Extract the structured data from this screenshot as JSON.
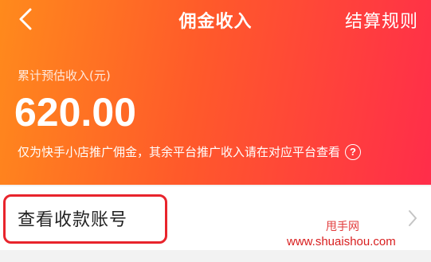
{
  "nav": {
    "title": "佣金收入",
    "rules_label": "结算规则",
    "back_icon": "chevron-left-icon"
  },
  "summary": {
    "label": "累计预估收入(元)",
    "amount": "620.00",
    "note": "仅为快手小店推广佣金，其余平台推广收入请在对应平台查看",
    "help_icon_glyph": "?"
  },
  "account": {
    "label": "查看收款账号",
    "chevron_icon": "chevron-right-icon"
  },
  "watermark": {
    "line1": "甩手网",
    "line2": "www.shuaishou.com"
  },
  "colors": {
    "gradient_start": "#ff8a1c",
    "gradient_end": "#ff2d4a",
    "highlight_border": "#e8242c"
  }
}
